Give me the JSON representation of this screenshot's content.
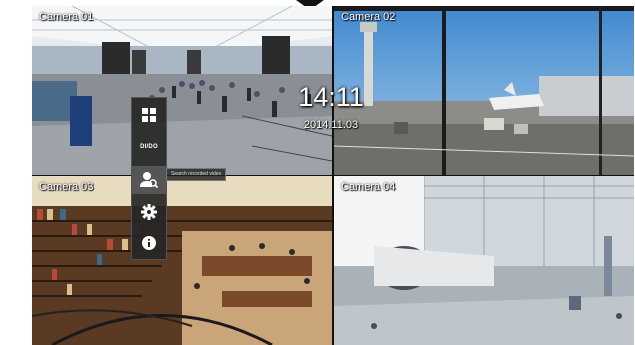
{
  "cameras": [
    {
      "label": "Camera 01"
    },
    {
      "label": "Camera 02"
    },
    {
      "label": "Camera 03"
    },
    {
      "label": "Camera 04"
    }
  ],
  "overlay": {
    "time": "14:11",
    "date": "2014.11.03"
  },
  "menu": {
    "items": [
      {
        "icon": "layout-grid-icon"
      },
      {
        "icon": "di-do-icon",
        "label": "DI/DO"
      },
      {
        "icon": "user-search-icon",
        "tooltip": "Search recorded video"
      },
      {
        "icon": "gear-icon"
      },
      {
        "icon": "info-icon"
      }
    ]
  },
  "colors": {
    "menu_bg": "#262626",
    "overlay_text": "#ffffff"
  }
}
